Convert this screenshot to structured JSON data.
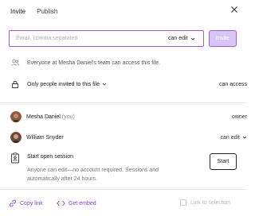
{
  "tabs": [
    {
      "label": "Invite",
      "active": true
    },
    {
      "label": "Publish",
      "active": false
    }
  ],
  "invite": {
    "email_placeholder": "Email, comma separated",
    "email_value": "",
    "permission": "can edit",
    "button_label": "Invite"
  },
  "team_access": {
    "text": "Everyone at Mesha Daniel's team can access this file."
  },
  "link_access": {
    "text": "Only people invited to this file",
    "permission": "can access"
  },
  "users": [
    {
      "name": "Mesha Daniel",
      "suffix": "(you)",
      "role": "owner"
    },
    {
      "name": "William Snyder",
      "suffix": "",
      "role": "can edit"
    }
  ],
  "open_session": {
    "title": "Start open session",
    "description": "Anyone can edit—no account required. Sessions and automatically after 24 hours.",
    "button_label": "Start"
  },
  "footer": {
    "copy_link": "Copy link",
    "get_embed": "Get embed",
    "link_to_selection": "Link to selection",
    "link_to_selection_checked": false
  },
  "colors": {
    "accent": "#9b59e8",
    "accent_link": "#7b3fd8",
    "invite_button_bg": "#d7c6f3"
  }
}
